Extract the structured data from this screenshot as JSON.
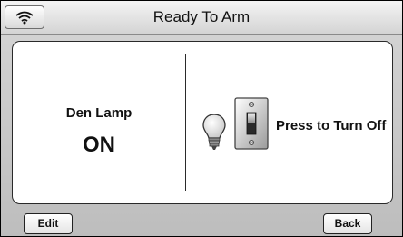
{
  "header": {
    "title": "Ready To Arm",
    "wifi_icon": "wifi-icon"
  },
  "device": {
    "name": "Den Lamp",
    "state": "ON",
    "icon": "light-bulb-icon",
    "switch_icon": "light-switch-icon",
    "action_label": "Press to Turn Off"
  },
  "footer": {
    "edit_label": "Edit",
    "back_label": "Back"
  }
}
